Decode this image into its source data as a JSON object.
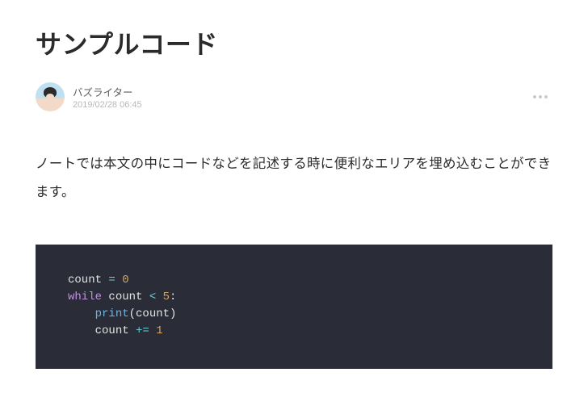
{
  "title": "サンプルコード",
  "author": {
    "name": "バズライター",
    "date": "2019/02/28 06:45"
  },
  "body": "ノートでは本文の中にコードなどを記述する時に便利なエリアを埋め込むことができます。",
  "code": {
    "line1_ident": "count",
    "line1_op": " = ",
    "line1_num": "0",
    "line2_kw": "while",
    "line2_cond_a": " count ",
    "line2_op": "<",
    "line2_cond_b": " ",
    "line2_num": "5",
    "line2_colon": ":",
    "line3_indent": "    ",
    "line3_func": "print",
    "line3_open": "(",
    "line3_arg": "count",
    "line3_close": ")",
    "line4_indent": "    ",
    "line4_ident": "count",
    "line4_op": " += ",
    "line4_num": "1"
  }
}
